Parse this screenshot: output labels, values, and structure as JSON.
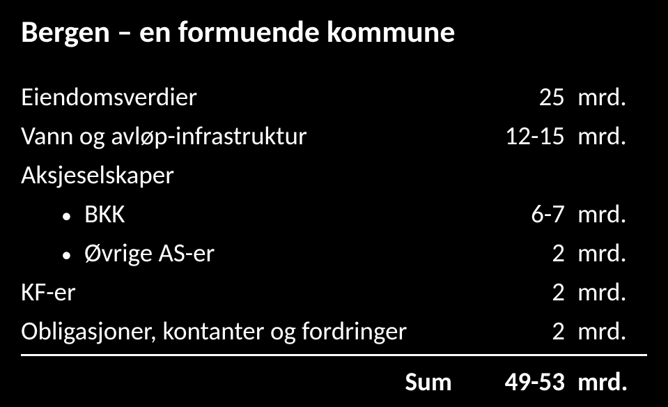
{
  "title": "Bergen – en formuende kommune",
  "rows": {
    "eiendomsverdier": {
      "label": "Eiendomsverdier",
      "value": "25",
      "unit": "mrd."
    },
    "vann": {
      "label": "Vann og avløp-infrastruktur",
      "value": "12-15",
      "unit": "mrd."
    },
    "aksjeselskaper": {
      "label": "Aksjeselskaper"
    },
    "bkk": {
      "label": "BKK",
      "value": "6-7",
      "unit": "mrd."
    },
    "ovrige": {
      "label": "Øvrige AS-er",
      "value": "2",
      "unit": "mrd."
    },
    "kfer": {
      "label": "KF-er",
      "value": "2",
      "unit": "mrd."
    },
    "obligasjoner": {
      "label": "Obligasjoner, kontanter og fordringer",
      "value": "2",
      "unit": "mrd."
    }
  },
  "sum": {
    "label": "Sum",
    "value": "49-53",
    "unit": "mrd."
  }
}
